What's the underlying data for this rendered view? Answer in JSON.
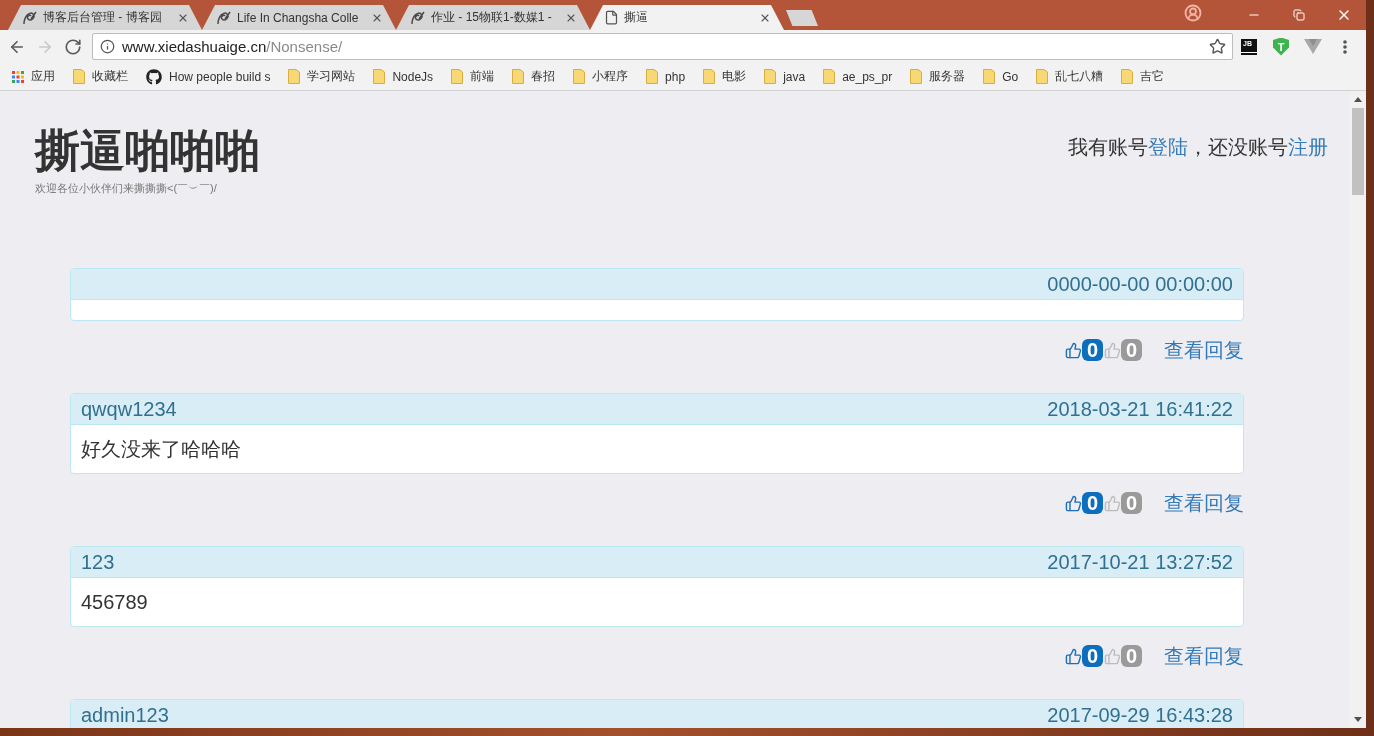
{
  "window": {
    "tabs": [
      {
        "kind": "site",
        "title": "博客后台管理 - 博客园",
        "selected": false
      },
      {
        "kind": "site",
        "title": "Life In Changsha Colle",
        "selected": false
      },
      {
        "kind": "site",
        "title": "作业 - 15物联1-数媒1 -",
        "selected": false
      },
      {
        "kind": "page",
        "title": "撕逼",
        "selected": true
      }
    ]
  },
  "toolbar": {
    "nav": [
      {
        "kind": "back",
        "disabled": false
      },
      {
        "kind": "forward",
        "disabled": true
      },
      {
        "kind": "reload",
        "disabled": false
      }
    ],
    "address": {
      "host": "www.xiedashuaige.cn",
      "path": "/Nonsense/"
    },
    "extensions": [
      {
        "kind": "tile",
        "label": "JB"
      },
      {
        "kind": "shield",
        "label": "T"
      },
      {
        "kind": "triangle"
      }
    ]
  },
  "bookmarks": [
    {
      "kind": "apps",
      "label": "应用"
    },
    {
      "kind": "folder",
      "label": "收藏栏"
    },
    {
      "kind": "github",
      "label": "How people build s"
    },
    {
      "kind": "folder",
      "label": "学习网站"
    },
    {
      "kind": "folder",
      "label": "NodeJs"
    },
    {
      "kind": "folder",
      "label": "前端"
    },
    {
      "kind": "folder",
      "label": "春招"
    },
    {
      "kind": "folder",
      "label": "小程序"
    },
    {
      "kind": "folder",
      "label": "php"
    },
    {
      "kind": "folder",
      "label": "电影"
    },
    {
      "kind": "folder",
      "label": "java"
    },
    {
      "kind": "folder",
      "label": "ae_ps_pr"
    },
    {
      "kind": "folder",
      "label": "服务器"
    },
    {
      "kind": "folder",
      "label": "Go"
    },
    {
      "kind": "folder",
      "label": "乱七八糟"
    },
    {
      "kind": "folder",
      "label": "吉它"
    }
  ],
  "page": {
    "title": "撕逼啪啪啪",
    "subtitle": "欢迎各位小伙伴们来撕撕撕<(￣︶￣)/",
    "account": {
      "have_account": "我有账号",
      "login_link": "登陆",
      "no_account": "，还没账号",
      "register_link": "注册"
    }
  },
  "posts": [
    {
      "date": "0000-00-00 00:00:00",
      "likes": "0",
      "dislikes": "0",
      "replies_link": "查看回复"
    },
    {
      "author": "qwqw1234",
      "date": "2018-03-21 16:41:22",
      "content": "好久没来了哈哈哈",
      "likes": "0",
      "dislikes": "0",
      "replies_link": "查看回复"
    },
    {
      "author": "123",
      "date": "2017-10-21 13:27:52",
      "content": "456789",
      "likes": "0",
      "dislikes": "0",
      "replies_link": "查看回复"
    },
    {
      "author": "admin123",
      "date": "2017-09-29 16:43:28"
    }
  ]
}
